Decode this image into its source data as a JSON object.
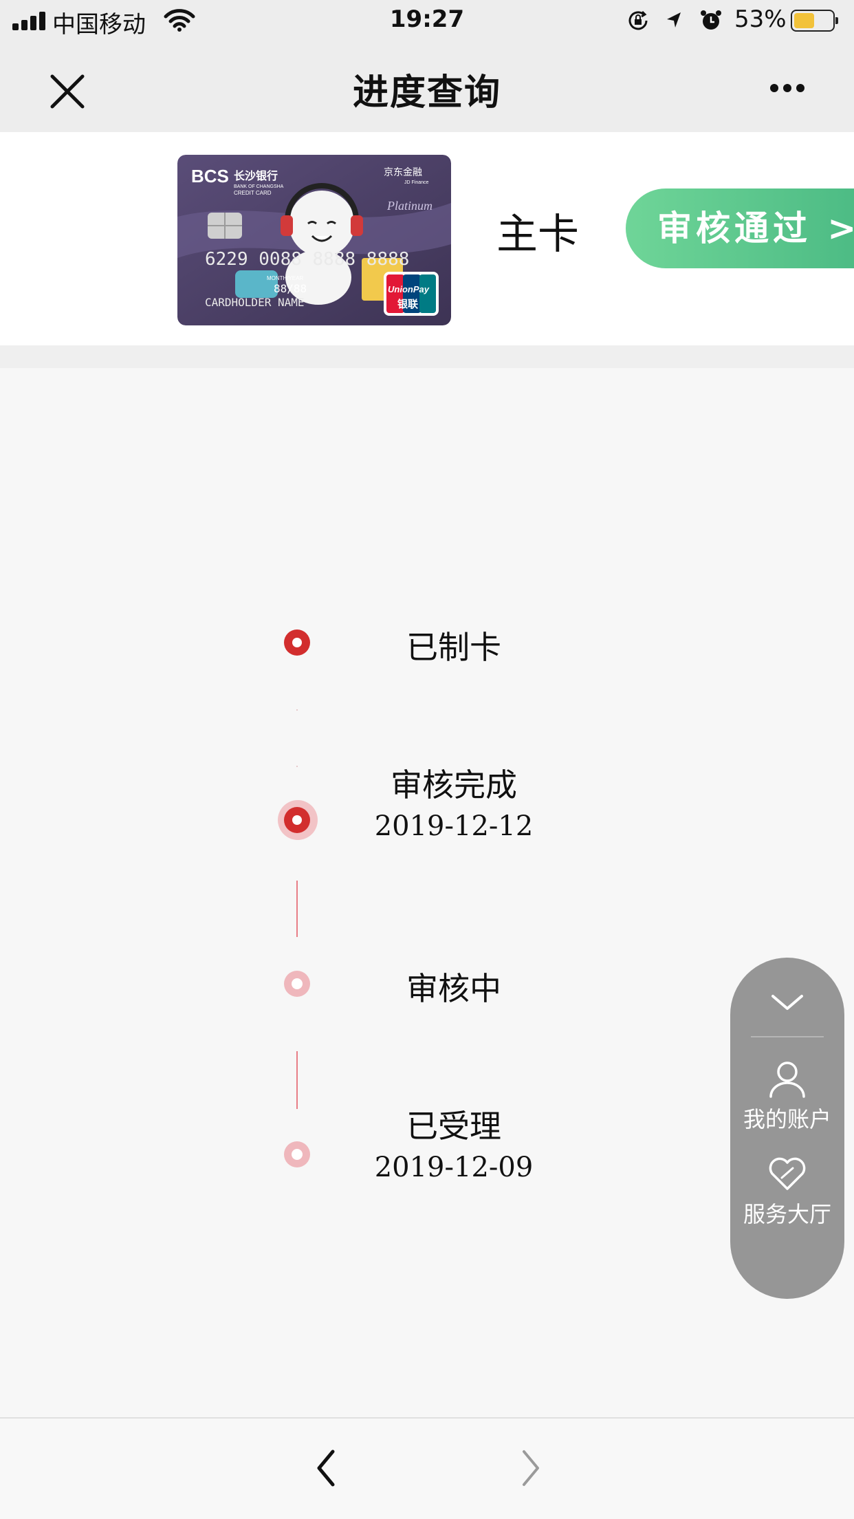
{
  "status_bar": {
    "carrier": "中国移动",
    "time": "19:27",
    "battery_percent": "53%",
    "battery_level": 0.53,
    "icons": [
      "signal-icon",
      "wifi-icon",
      "orientation-lock-icon",
      "location-icon",
      "alarm-icon",
      "battery-icon"
    ]
  },
  "nav": {
    "title": "进度查询",
    "close_icon": "close-icon",
    "more_icon": "more-icon"
  },
  "card": {
    "bank_logo": "BCS",
    "bank_name": "长沙银行",
    "bank_name_en": "BANK OF CHANGSHA",
    "card_label": "CREDIT CARD",
    "partner": "京东金融",
    "partner_en": "JD Finance",
    "tier": "Platinum",
    "number": "6229 0088 8888 8888",
    "validity_label": "MONTH/YEAR",
    "expiry": "88/88",
    "holder": "CARDHOLDER NAME",
    "network": "UnionPay",
    "network_cn": "银联",
    "type": "主卡",
    "status": "审核通过 >",
    "status_color": "#5cc68d"
  },
  "timeline": {
    "steps": [
      {
        "label": "已制卡",
        "date": "",
        "state": "done"
      },
      {
        "label": "审核完成",
        "date": "2019-12-12",
        "state": "current"
      },
      {
        "label": "审核中",
        "date": "",
        "state": "pending"
      },
      {
        "label": "已受理",
        "date": "2019-12-09",
        "state": "pending"
      }
    ],
    "accent": "#d22e2e"
  },
  "float_menu": {
    "items": [
      {
        "label": "我的账户",
        "icon": "person-icon"
      },
      {
        "label": "服务大厅",
        "icon": "heart-icon"
      }
    ]
  },
  "bottom_nav": {
    "back_icon": "chevron-left-icon",
    "forward_icon": "chevron-right-icon"
  }
}
